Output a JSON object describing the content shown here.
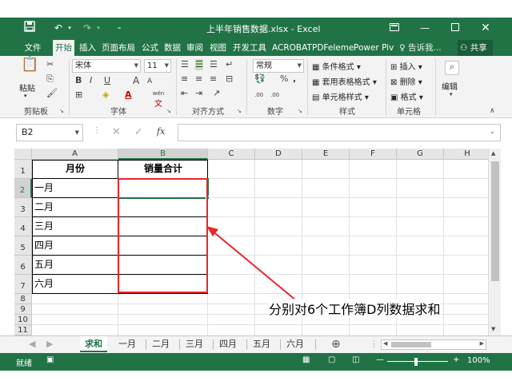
{
  "window": {
    "title": "上半年销售数据.xlsx - Excel",
    "share_label": "共享"
  },
  "ribbon_tabs": [
    "文件",
    "开始",
    "插入",
    "页面布局",
    "公式",
    "数据",
    "审阅",
    "视图",
    "开发工具",
    "ACROBAT",
    "PDFeleme",
    "Power Piv",
    "告诉我..."
  ],
  "ribbon": {
    "paste_label": "粘贴",
    "clipboard_label": "剪贴板",
    "font_name": "宋体",
    "font_size": "11",
    "font_label": "字体",
    "align_label": "对齐方式",
    "number_format": "常规",
    "number_label": "数字",
    "cond_format": "条件格式",
    "table_format": "套用表格格式",
    "cell_style": "单元格样式",
    "styles_label": "样式",
    "insert": "插入",
    "delete": "删除",
    "format": "格式",
    "cells_label": "单元格",
    "edit_label": "编辑",
    "bold": "B",
    "italic": "I",
    "underline": "U",
    "grow_font": "A",
    "shrink_font": "A",
    "wen": "wén",
    "wen_char": "文",
    "percent": "%",
    "comma": ",",
    "inc_decimal": ".00",
    "dec_decimal": ".00"
  },
  "formula_bar": {
    "name_box": "B2",
    "fx": "fx"
  },
  "columns": [
    "A",
    "B",
    "C",
    "D",
    "E",
    "F",
    "G",
    "H"
  ],
  "rows": [
    "1",
    "2",
    "3",
    "4",
    "5",
    "6",
    "7",
    "8",
    "9",
    "10",
    "11"
  ],
  "cells": {
    "A1": "月份",
    "B1": "销量合计",
    "A2": "一月",
    "A3": "二月",
    "A4": "三月",
    "A5": "四月",
    "A6": "五月",
    "A7": "六月"
  },
  "annotation": {
    "text": "分别对6个工作簿D列数据求和",
    "color": "#e8262a"
  },
  "sheet_tabs": [
    "求和",
    "一月",
    "二月",
    "三月",
    "四月",
    "五月",
    "六月"
  ],
  "status": {
    "ready": "就绪",
    "zoom": "100%"
  },
  "colors": {
    "excel_green": "#217346",
    "highlight_red": "#e8262a"
  }
}
